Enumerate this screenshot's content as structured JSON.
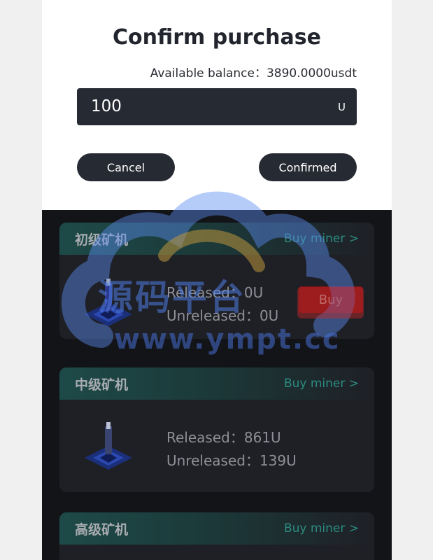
{
  "modal": {
    "title": "Confirm purchase",
    "balance_label": "Available balance：",
    "balance_value": "3890.0000usdt",
    "amount_value": "100",
    "amount_unit": "U",
    "cancel_label": "Cancel",
    "confirm_label": "Confirmed"
  },
  "miners": [
    {
      "title": "初级矿机",
      "buy_link": "Buy miner >",
      "released": "Released：0U",
      "unreleased": "Unreleased：0U",
      "buy_label": "Buy"
    },
    {
      "title": "中级矿机",
      "buy_link": "Buy miner >",
      "released": "Released：861U",
      "unreleased": "Unreleased：139U"
    },
    {
      "title": "高级矿机",
      "buy_link": "Buy miner >"
    }
  ],
  "watermark": {
    "line1": "源码平台",
    "line2": "www.ympt.cc"
  },
  "colors": {
    "accent_green": "#2c8b7e",
    "button_dark": "#262a33",
    "buy_red": "#7a1519"
  }
}
